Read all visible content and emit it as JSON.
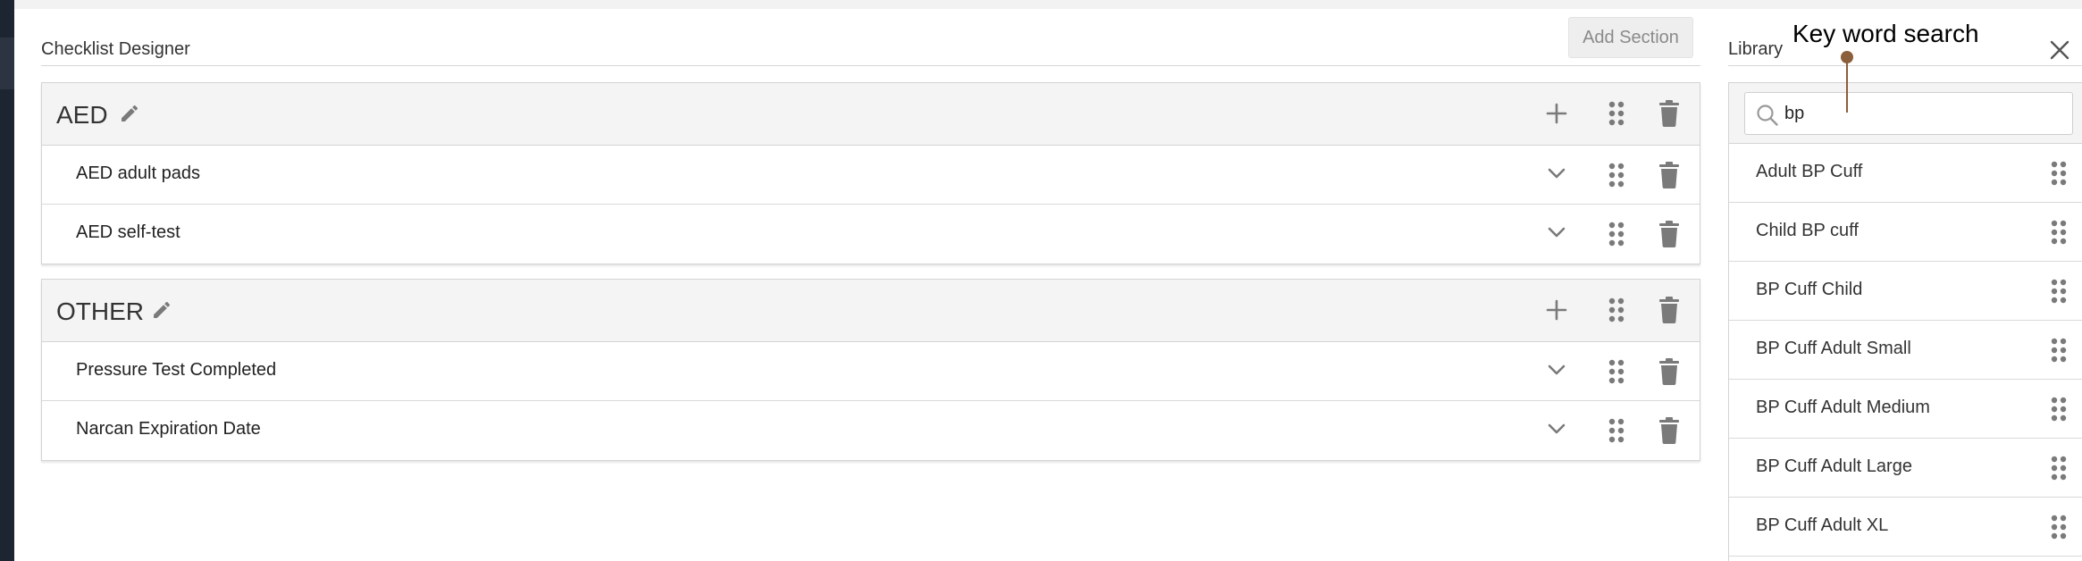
{
  "designer": {
    "title": "Checklist Designer",
    "add_section_label": "Add Section",
    "sections": [
      {
        "name": "AED",
        "items": [
          {
            "label": "AED adult pads"
          },
          {
            "label": "AED self-test"
          }
        ]
      },
      {
        "name": "OTHER",
        "items": [
          {
            "label": "Pressure Test Completed"
          },
          {
            "label": "Narcan Expiration Date"
          }
        ]
      }
    ]
  },
  "library": {
    "title": "Library",
    "search_value": "bp",
    "items": [
      {
        "label": "Adult BP Cuff"
      },
      {
        "label": "Child BP cuff"
      },
      {
        "label": "BP Cuff Child"
      },
      {
        "label": "BP Cuff Adult Small"
      },
      {
        "label": "BP Cuff Adult Medium"
      },
      {
        "label": "BP Cuff Adult Large"
      },
      {
        "label": "BP Cuff Adult XL"
      }
    ]
  },
  "annotation": {
    "text": "Key word search"
  },
  "icons": {
    "edit": "pencil-icon",
    "add": "plus-icon",
    "drag": "drag-handle-icon",
    "delete": "trash-icon",
    "expand": "chevron-down-icon",
    "search": "search-icon",
    "close": "close-icon"
  },
  "colors": {
    "icon": "#7a7a7a",
    "annotation": "#8b5e3c",
    "section_header_bg": "#f4f4f4"
  }
}
